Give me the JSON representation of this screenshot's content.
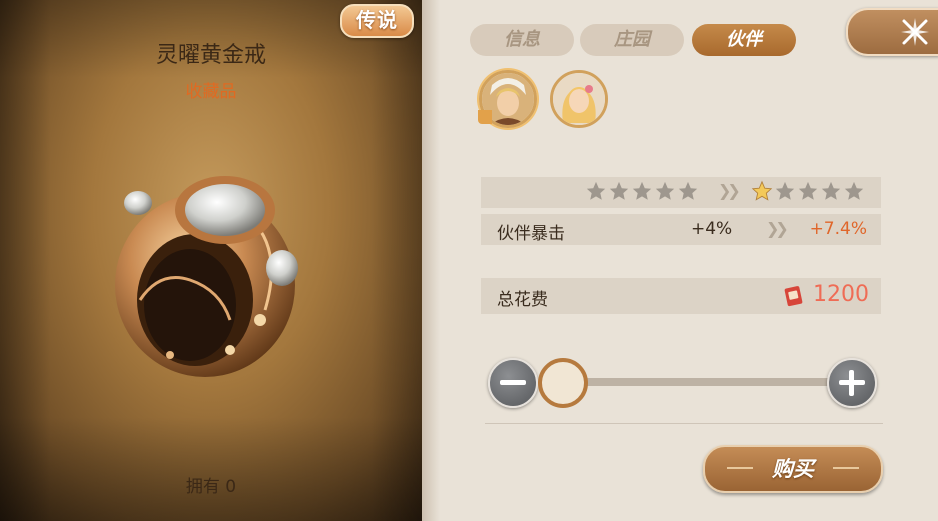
{
  "item": {
    "rarity": "传说",
    "name": "灵曜黄金戒",
    "category": "收藏品",
    "owned_label": "拥有 0"
  },
  "tabs": [
    {
      "label": "信息",
      "active": false
    },
    {
      "label": "庄园",
      "active": false
    },
    {
      "label": "伙伴",
      "active": true
    }
  ],
  "partners": [
    {
      "name": "partner-1",
      "selected": true
    },
    {
      "name": "partner-2",
      "selected": false
    }
  ],
  "upgrade": {
    "current_stars": 5,
    "current_stars_filled": 0,
    "next_stars": 5,
    "next_stars_filled": 1,
    "stat_label": "伙伴暴击",
    "stat_current": "+4%",
    "stat_next": "+7.4%"
  },
  "cost": {
    "label": "总花费",
    "value": "1200",
    "currency_icon": "coupon-icon"
  },
  "slider": {
    "level": 0
  },
  "buy_label": "购买",
  "colors": {
    "accent": "#e0662a",
    "cost": "#ef6c55",
    "tab_active": "#b8783a"
  }
}
